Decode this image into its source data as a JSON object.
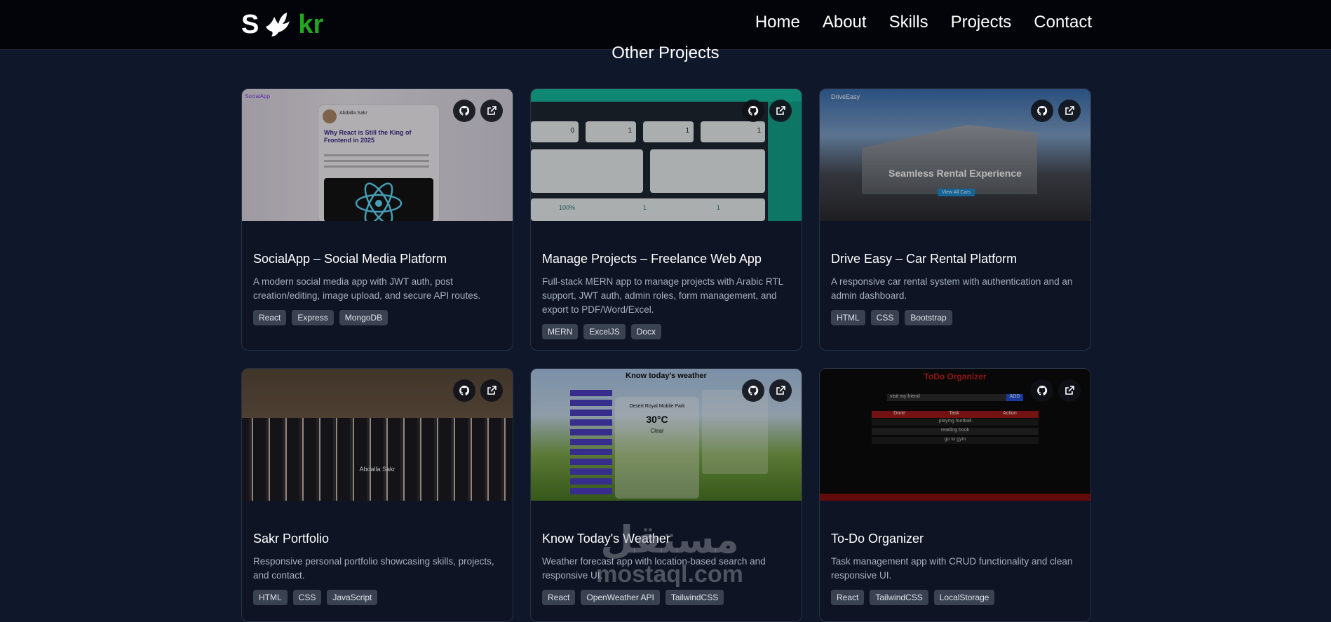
{
  "nav": {
    "logo_s": "S",
    "logo_kr": "kr",
    "links": [
      "Home",
      "About",
      "Skills",
      "Projects",
      "Contact"
    ]
  },
  "section": {
    "title": "Other Projects"
  },
  "cards": [
    {
      "title": "SocialApp – Social Media Platform",
      "description": "A modern social media app with JWT auth, post creation/editing, image upload, and secure API routes.",
      "tags": [
        "React",
        "Express",
        "MongoDB"
      ],
      "thumb": {
        "brand": "SocialApp",
        "author": "Abdalla Sakr",
        "post_title": "Why React is Still the King of Frontend in 2025"
      }
    },
    {
      "title": "Manage Projects – Freelance Web App",
      "description": "Full-stack MERN app to manage projects with Arabic RTL support, JWT auth, admin roles, form management, and export to PDF/Word/Excel.",
      "tags": [
        "MERN",
        "ExcelJS",
        "Docx"
      ],
      "thumb": {
        "stats": [
          "0",
          "1",
          "1",
          "1"
        ],
        "metrics": [
          "100%",
          "1",
          "1"
        ]
      }
    },
    {
      "title": "Drive Easy – Car Rental Platform",
      "description": "A responsive car rental system with authentication and an admin dashboard.",
      "tags": [
        "HTML",
        "CSS",
        "Bootstrap"
      ],
      "thumb": {
        "brand": "DriveEasy",
        "headline": "Seamless Rental Experience",
        "cta": "View All Cars"
      }
    },
    {
      "title": "Sakr Portfolio",
      "description": "Responsive personal portfolio showcasing skills, projects, and contact.",
      "tags": [
        "HTML",
        "CSS",
        "JavaScript"
      ],
      "thumb": {
        "name": "Abdalla Sakr"
      }
    },
    {
      "title": "Know Today's Weather",
      "description": "Weather forecast app with location-based search and responsive UI.",
      "tags": [
        "React",
        "OpenWeather API",
        "TailwindCSS"
      ],
      "thumb": {
        "header": "Know today's weather",
        "place": "Desert Royal Mobile Park",
        "temp": "30°C",
        "condition": "Clear"
      }
    },
    {
      "title": "To-Do Organizer",
      "description": "Task management app with CRUD functionality and clean responsive UI.",
      "tags": [
        "React",
        "TailwindCSS",
        "LocalStorage"
      ],
      "thumb": {
        "header": "ToDo Organizer",
        "input": "visit my friend",
        "add": "ADD",
        "cols": [
          "Done",
          "Task",
          "Action"
        ],
        "rows": [
          "playing football",
          "reading book",
          "go to gym"
        ]
      }
    }
  ],
  "watermark": {
    "arabic": "مستقل",
    "latin": "mostaql.com"
  },
  "colors": {
    "background": "#0f172a",
    "card": "#0e1424",
    "accent": "#22a722",
    "tag": "#3a4252"
  }
}
